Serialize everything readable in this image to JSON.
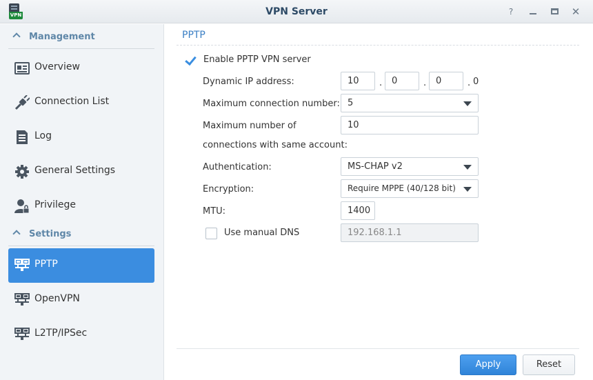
{
  "window": {
    "title": "VPN Server",
    "app_icon_badge": "VPN",
    "help_label": "?",
    "close_label": "✕"
  },
  "sidebar": {
    "sections": [
      {
        "label": "Management",
        "items": [
          {
            "label": "Overview",
            "icon": "overview-icon"
          },
          {
            "label": "Connection List",
            "icon": "connection-list-icon"
          },
          {
            "label": "Log",
            "icon": "log-icon"
          },
          {
            "label": "General Settings",
            "icon": "gear-icon"
          },
          {
            "label": "Privilege",
            "icon": "privilege-icon"
          }
        ]
      },
      {
        "label": "Settings",
        "items": [
          {
            "label": "PPTP",
            "icon": "network-icon",
            "active": true
          },
          {
            "label": "OpenVPN",
            "icon": "network-icon"
          },
          {
            "label": "L2TP/IPSec",
            "icon": "network-icon"
          }
        ]
      }
    ]
  },
  "main": {
    "title": "PPTP",
    "enable": {
      "label": "Enable PPTP VPN server",
      "checked": true
    },
    "dynamic_ip": {
      "label": "Dynamic IP address:",
      "octets": [
        "10",
        "0",
        "0",
        "0"
      ],
      "separator": "."
    },
    "max_conn": {
      "label": "Maximum connection number:",
      "value": "5"
    },
    "max_same_account": {
      "label_line1": "Maximum number of",
      "label_line2": "connections with same account:",
      "value": "10"
    },
    "authentication": {
      "label": "Authentication:",
      "value": "MS-CHAP v2"
    },
    "encryption": {
      "label": "Encryption:",
      "value": "Require MPPE (40/128 bit)"
    },
    "mtu": {
      "label": "MTU:",
      "value": "1400"
    },
    "manual_dns": {
      "label": "Use manual DNS",
      "checked": false,
      "value": "192.168.1.1"
    }
  },
  "footer": {
    "apply_label": "Apply",
    "reset_label": "Reset"
  },
  "colors": {
    "accent": "#3b8de0",
    "section_header": "#5f87a8",
    "title_text": "#2d4a66"
  }
}
